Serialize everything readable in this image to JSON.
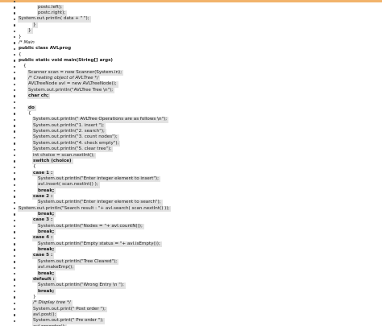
{
  "colors": {
    "accent_bar": "#f2b36b",
    "highlight": "#e3e3e3",
    "text": "#1a1a1a"
  },
  "lines": [
    {
      "indent": 3,
      "text": "",
      "style": "normal",
      "hl": false
    },
    {
      "indent": 4,
      "text": "postc.left);",
      "style": "normal",
      "hl": true
    },
    {
      "indent": 4,
      "text": "postc.right);",
      "style": "normal",
      "hl": true
    },
    {
      "indent": 0,
      "text": "System.out.println( data + \" \");",
      "style": "normal",
      "hl": true
    },
    {
      "indent": 3,
      "text": "}",
      "style": "normal",
      "hl": true
    },
    {
      "indent": 2,
      "text": "}",
      "style": "normal",
      "hl": true
    },
    {
      "indent": 0,
      "text": "}",
      "style": "normal",
      "hl": false
    },
    {
      "indent": 0,
      "text": "/* Main",
      "style": "comment",
      "hl": false
    },
    {
      "indent": 0,
      "text": "public class AVLprog",
      "style": "keyword",
      "hl": false
    },
    {
      "indent": 0,
      "text": "{",
      "style": "normal",
      "hl": false
    },
    {
      "indent": 0,
      "text": "public static void main(String[] args)",
      "style": "keyword",
      "hl": false
    },
    {
      "indent": 1,
      "text": "{",
      "style": "normal",
      "hl": false
    },
    {
      "indent": 2,
      "text": "Scanner scan = new Scanner(System.in);",
      "style": "normal",
      "hl": true
    },
    {
      "indent": 2,
      "text": "/* Creating object of AVLTree */",
      "style": "comment",
      "hl": true
    },
    {
      "indent": 2,
      "text": "AVLTreeNode avl = new AVLTreeNode();",
      "style": "normal",
      "hl": true
    },
    {
      "indent": 2,
      "text": "System.out.println(\"AVLTree Tree \\n\");",
      "style": "normal",
      "hl": true
    },
    {
      "indent": 2,
      "text": "char ch;",
      "style": "keyword",
      "hl": true
    },
    {
      "indent": 0,
      "text": "",
      "style": "normal",
      "hl": false
    },
    {
      "indent": 2,
      "text": "do",
      "style": "keyword",
      "hl": true
    },
    {
      "indent": 2,
      "text": "{",
      "style": "normal",
      "hl": false
    },
    {
      "indent": 3,
      "text": "System.out.println(\" AVLTree Operations are as follows \\n\");",
      "style": "normal",
      "hl": true
    },
    {
      "indent": 3,
      "text": "System.out.println(\"1. insert \");",
      "style": "normal",
      "hl": true
    },
    {
      "indent": 3,
      "text": "System.out.println(\"2. search\");",
      "style": "normal",
      "hl": true
    },
    {
      "indent": 3,
      "text": "System.out.println(\"3. count nodes\");",
      "style": "normal",
      "hl": true
    },
    {
      "indent": 3,
      "text": "System.out.println(\"4. check empty\");",
      "style": "normal",
      "hl": true
    },
    {
      "indent": 3,
      "text": "System.out.println(\"5. clear tree\");",
      "style": "normal",
      "hl": true
    },
    {
      "indent": 3,
      "text": "int choice = scan.nextInt();",
      "style": "normal",
      "hl": true
    },
    {
      "indent": 3,
      "text": "switch (choice)",
      "style": "keyword",
      "hl": true
    },
    {
      "indent": 3,
      "text": "{",
      "style": "normal",
      "hl": false
    },
    {
      "indent": 3,
      "text": "case 1 :",
      "style": "keyword",
      "hl": true
    },
    {
      "indent": 4,
      "text": "System.out.println(\"Enter integer element to insert\");",
      "style": "normal",
      "hl": true
    },
    {
      "indent": 4,
      "text": "avl.insert( scan.nextInt() );",
      "style": "normal",
      "hl": true
    },
    {
      "indent": 4,
      "text": "break;",
      "style": "keyword",
      "hl": true
    },
    {
      "indent": 3,
      "text": "case 2 :",
      "style": "keyword",
      "hl": true
    },
    {
      "indent": 4,
      "text": "System.out.println(\"Enter integer element to search\");",
      "style": "normal",
      "hl": true
    },
    {
      "indent": 0,
      "text": "System.out.println(\"Search result : \"+ avl.search( scan.nextInt() ));",
      "style": "normal",
      "hl": true
    },
    {
      "indent": 4,
      "text": "break;",
      "style": "keyword",
      "hl": true
    },
    {
      "indent": 3,
      "text": "case 3 :",
      "style": "keyword",
      "hl": true
    },
    {
      "indent": 4,
      "text": "System.out.println(\"Nodes = \"+ avl.countN());",
      "style": "normal",
      "hl": true
    },
    {
      "indent": 4,
      "text": "break;",
      "style": "keyword",
      "hl": true
    },
    {
      "indent": 3,
      "text": "case 4 :",
      "style": "keyword",
      "hl": true
    },
    {
      "indent": 4,
      "text": "System.out.println(\"Empty status = \"+ avl.isEmpty());",
      "style": "normal",
      "hl": true
    },
    {
      "indent": 4,
      "text": "break;",
      "style": "keyword",
      "hl": true
    },
    {
      "indent": 3,
      "text": "case 5 :",
      "style": "keyword",
      "hl": true
    },
    {
      "indent": 4,
      "text": "System.out.println(\"Tree Cleared\");",
      "style": "normal",
      "hl": true
    },
    {
      "indent": 4,
      "text": "avl.makeEmp();",
      "style": "normal",
      "hl": true
    },
    {
      "indent": 4,
      "text": "break;",
      "style": "keyword",
      "hl": true
    },
    {
      "indent": 3,
      "text": "default :",
      "style": "keyword",
      "hl": true
    },
    {
      "indent": 4,
      "text": "System.out.println(\"Wrong Entry \\n \");",
      "style": "normal",
      "hl": true
    },
    {
      "indent": 4,
      "text": "break;",
      "style": "keyword",
      "hl": true
    },
    {
      "indent": 3,
      "text": "}",
      "style": "normal",
      "hl": false
    },
    {
      "indent": 3,
      "text": "/* Display tree */",
      "style": "comment",
      "hl": true
    },
    {
      "indent": 3,
      "text": "System.out.print(\" Post order \");",
      "style": "normal",
      "hl": true
    },
    {
      "indent": 3,
      "text": "avl.post();",
      "style": "normal",
      "hl": true
    },
    {
      "indent": 3,
      "text": "System.out.print(\" Pre order \");",
      "style": "normal",
      "hl": true
    },
    {
      "indent": 3,
      "text": "avl.preorder();",
      "style": "normal",
      "hl": true
    }
  ]
}
